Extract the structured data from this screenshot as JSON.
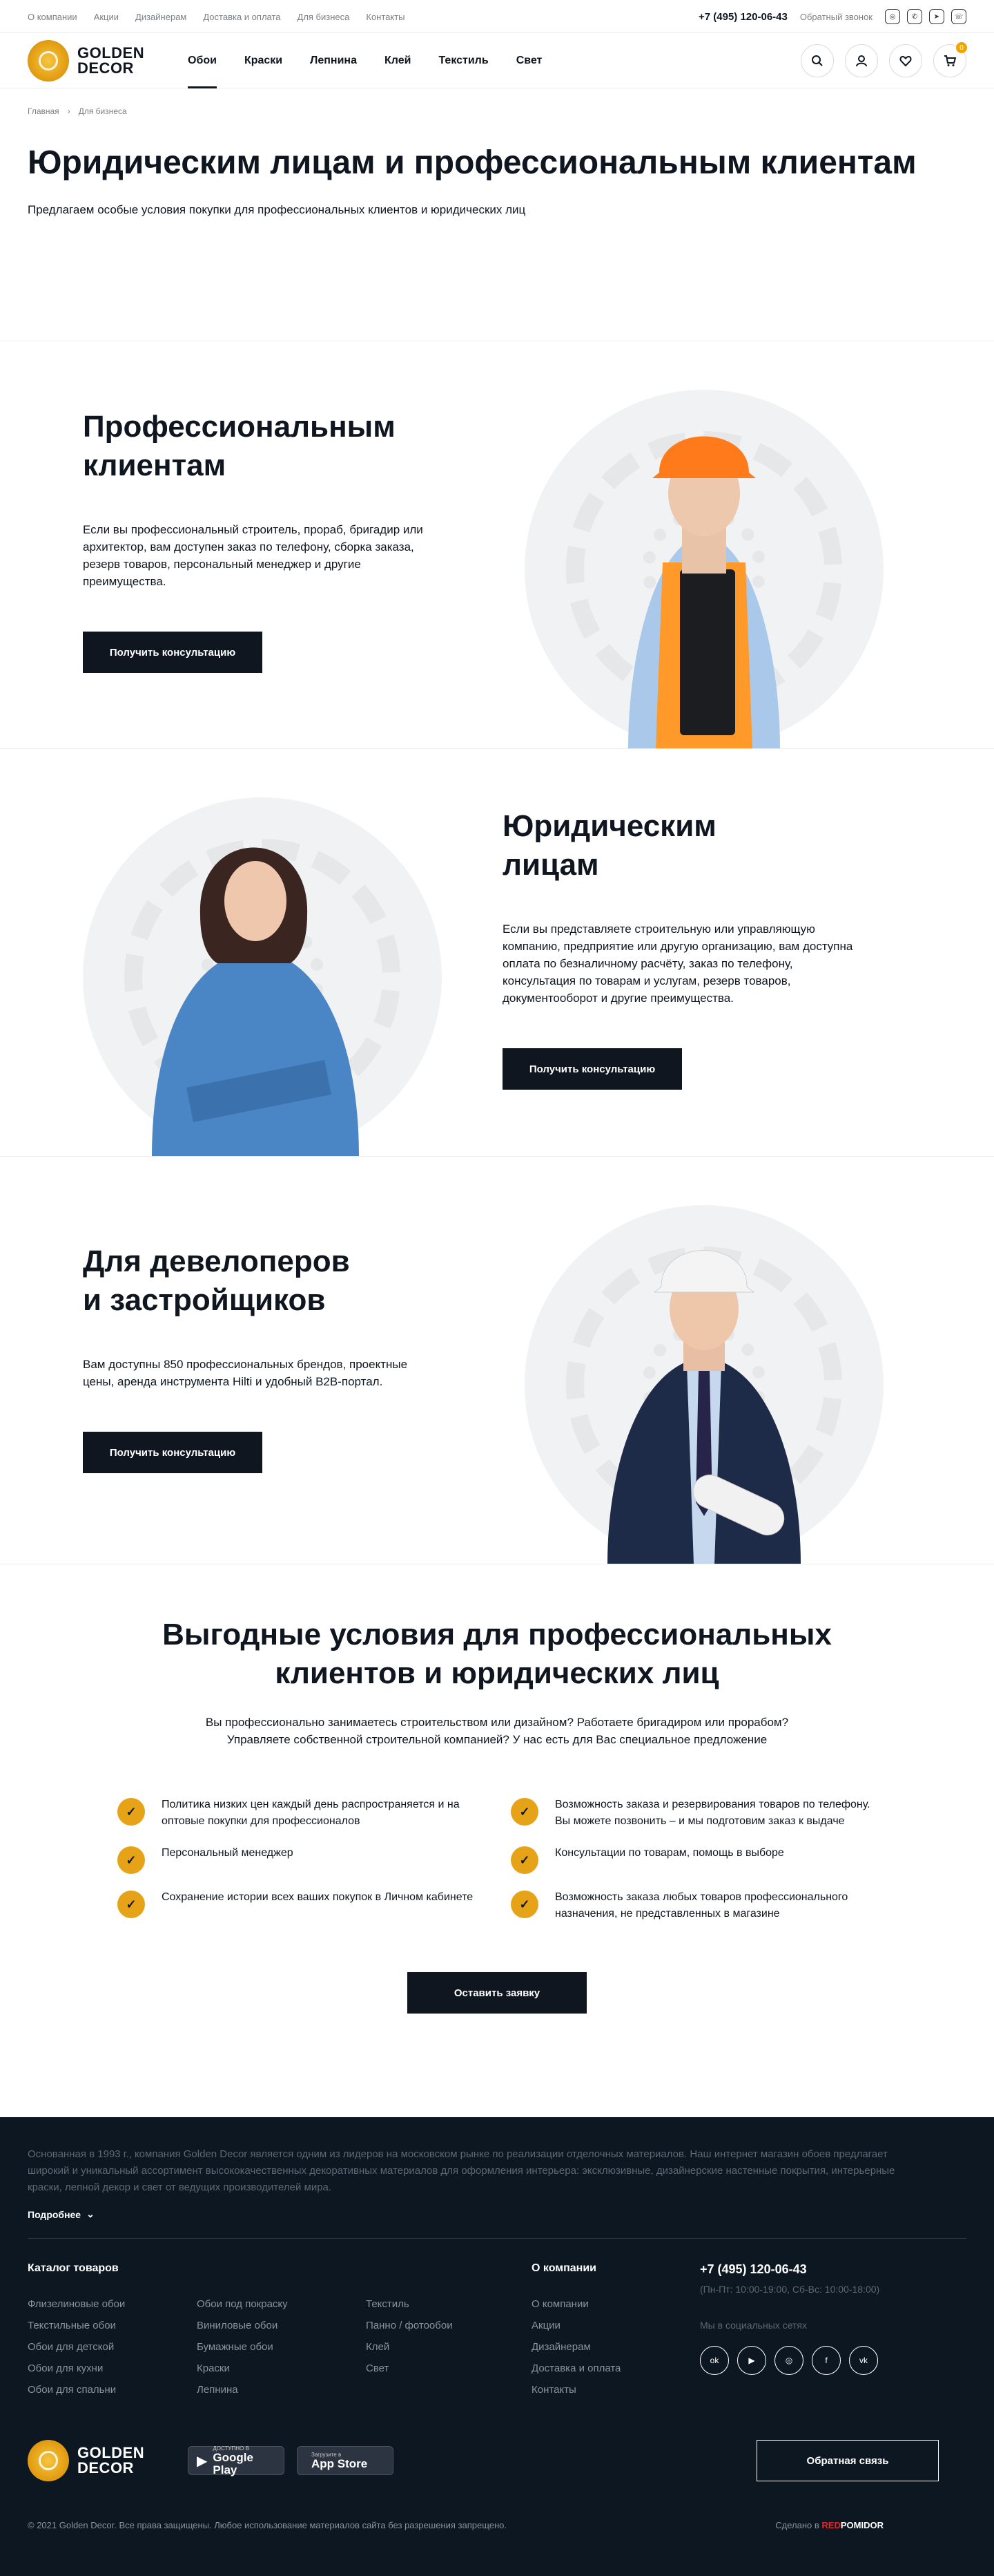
{
  "topbar": {
    "links": [
      "О компании",
      "Акции",
      "Дизайнерам",
      "Доставка и оплата",
      "Для бизнеса",
      "Контакты"
    ],
    "phone": "+7 (495) 120-06-43",
    "callback": "Обратный звонок"
  },
  "header": {
    "logo_line1": "GOLDEN",
    "logo_line2": "DECOR",
    "nav": [
      "Обои",
      "Краски",
      "Лепнина",
      "Клей",
      "Текстиль",
      "Свет"
    ],
    "cart_count": "0"
  },
  "breadcrumb": [
    "Главная",
    "Для бизнеса"
  ],
  "hero": {
    "title": "Юридическим лицам и профессиональным клиентам",
    "lead": "Предлагаем особые условия покупки для профессиональных клиентов и юридических лиц"
  },
  "sections": [
    {
      "title_l1": "Профессиональным",
      "title_l2": "клиентам",
      "text": "Если вы профессиональный строитель, прораб, бригадир или архитектор, вам доступен заказ по телефону, сборка заказа, резерв товаров, персональный менеджер и другие преимущества.",
      "button": "Получить консультацию"
    },
    {
      "title_l1": "Юридическим",
      "title_l2": "лицам",
      "text": "Если вы представляете строительную или управляющую компанию, предприятие или другую организацию, вам доступна оплата по безналичному расчёту, заказ по телефону, консультация по товарам и услугам, резерв товаров, документооборот и другие преимущества.",
      "button": "Получить консультацию"
    },
    {
      "title_l1": "Для девелоперов",
      "title_l2": "и застройщиков",
      "text": "Вам доступны 850 профессиональных брендов, проектные цены, аренда инструмента Hilti и удобный B2B-портал.",
      "button": "Получить консультацию"
    }
  ],
  "benefits": {
    "title": "Выгодные условия для профессиональных клиентов и юридических лиц",
    "subtitle": "Вы профессионально занимаетесь строительством или дизайном? Работаете бригадиром или прорабом? Управляете собственной строительной компанией? У нас есть для Вас специальное предложение",
    "items": [
      "Политика низких цен каждый день распространяется и на оптовые покупки для профессионалов",
      "Возможность заказа и резервирования товаров по телефону. Вы можете позвонить – и мы подготовим заказ к выдаче",
      "Персональный менеджер",
      "Консультации по товарам, помощь в выборе",
      "Сохранение истории всех ваших покупок в Личном кабинете",
      "Возможность заказа любых товаров профессионального назначения, не представленных в магазине"
    ],
    "button": "Оставить заявку"
  },
  "footer": {
    "about": "Основанная в 1993 г., компания Golden Decor является одним из лидеров на московском рынке по реализации отделочных материалов. Наш интернет магазин обоев предлагает широкий и уникальный ассортимент высококачественных декоративных материалов для оформления интерьера: эксклюзивные, дизайнерские настенные покрытия, интерьерные краски, лепной декор и свет от ведущих производителей мира.",
    "more": "Подробнее",
    "catalog_title": "Каталог товаров",
    "catalog": [
      "Флизелиновые обои",
      "Обои под покраску",
      "Текстиль",
      "Текстильные обои",
      "Виниловые обои",
      "Панно / фотообои",
      "Обои для детской",
      "Бумажные обои",
      "Клей",
      "Обои для кухни",
      "Краски",
      "Свет",
      "Обои для спальни",
      "Лепнина",
      ""
    ],
    "company_title": "О компании",
    "company_links": [
      "О компании",
      "Акции",
      "Дизайнерам",
      "Доставка и оплата",
      "Контакты"
    ],
    "phone": "+7 (495) 120-06-43",
    "hours": "(Пн-Пт: 10:00-19:00, Сб-Вс: 10:00-18:00)",
    "social_title": "Мы в социальных сетях",
    "gplay_small": "ДОСТУПНО В",
    "gplay_big": "Google Play",
    "appstore_small": "Загрузите в",
    "appstore_big": "App Store",
    "feedback": "Обратная связь",
    "copyright": "© 2021 Golden Decor. Все права защищены. Любое использование материалов сайта без разрешения запрещено.",
    "made_by": "Сделано в",
    "made_by_a": "RED",
    "made_by_b": "POMIDOR"
  }
}
